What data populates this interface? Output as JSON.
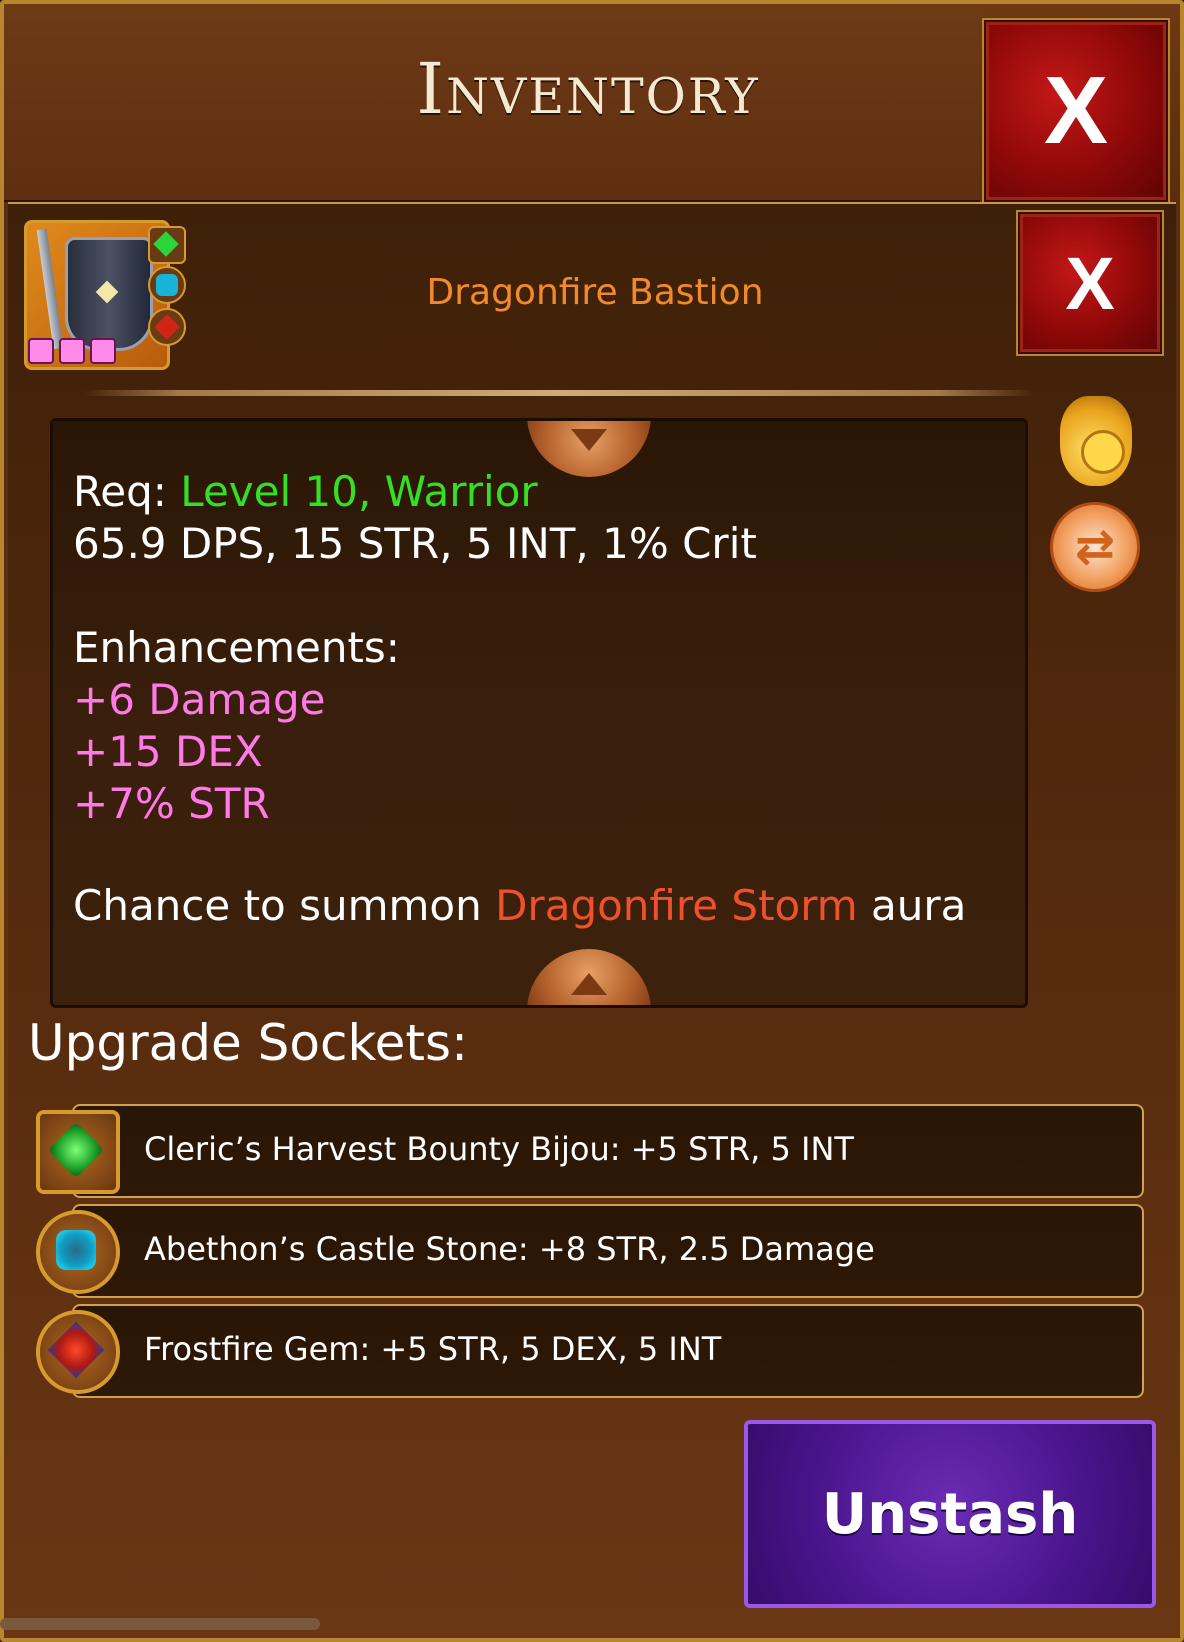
{
  "window": {
    "title": "Inventory",
    "close_label": "X"
  },
  "item": {
    "name": "Dragonfire Bastion",
    "close_label": "X",
    "icon": "shield-with-sword-icon",
    "socket_pips": 3
  },
  "description": {
    "req_prefix": "Req: ",
    "req_value": "Level 10, Warrior",
    "stats": "65.9 DPS, 15 STR, 5 INT, 1% Crit",
    "enhancements_title": "Enhancements:",
    "enhancements": [
      "+6 Damage",
      "+15 DEX",
      "+7% STR"
    ],
    "effect_prefix": "Chance to summon ",
    "effect_name": "Dragonfire Storm",
    "effect_suffix": " aura"
  },
  "side_icons": [
    "coin-bag-icon",
    "swap-icon"
  ],
  "sockets": {
    "title": "Upgrade Sockets:",
    "items": [
      {
        "label": "Cleric’s Harvest Bounty Bijou: +5 STR, 5 INT",
        "icon": "green-gem-icon"
      },
      {
        "label": "Abethon’s Castle Stone: +8 STR, 2.5 Damage",
        "icon": "cyan-gem-icon"
      },
      {
        "label": "Frostfire Gem: +5 STR, 5 DEX, 5 INT",
        "icon": "red-gem-icon"
      }
    ]
  },
  "actions": {
    "unstash_label": "Unstash"
  },
  "colors": {
    "requirement": "#34e024",
    "enhancement": "#ff7ae6",
    "effect": "#f0502c",
    "item_name": "#f08a2a"
  }
}
